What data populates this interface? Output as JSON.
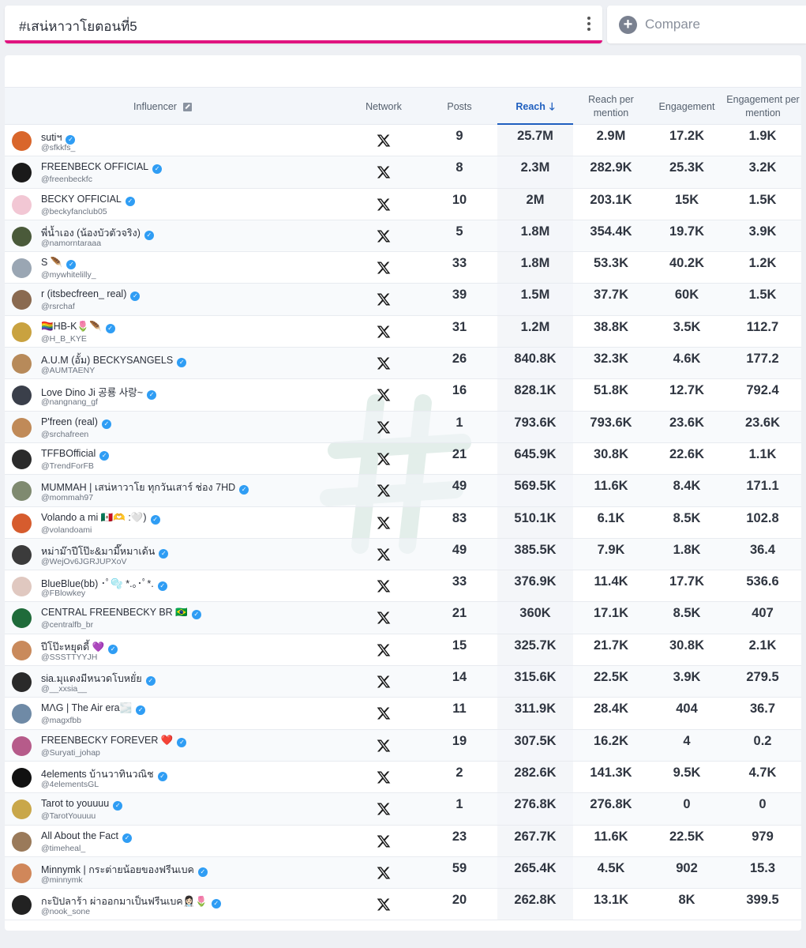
{
  "search": {
    "hashtag": "#เสน่หาวาโยตอนที่5",
    "compare_label": "Compare"
  },
  "table": {
    "headers": {
      "influencer": "Influencer",
      "network": "Network",
      "posts": "Posts",
      "reach": "Reach",
      "reach_per_mention": "Reach per mention",
      "engagement": "Engagement",
      "engagement_per_mention": "Engagement per mention"
    },
    "rows": [
      {
        "name": "sutiฯ",
        "handle": "@sfkkfs_",
        "posts": "9",
        "reach": "25.7M",
        "rpm": "2.9M",
        "eng": "17.2K",
        "epm": "1.9K",
        "avatar": "#d9662b"
      },
      {
        "name": "FREENBECK OFFICIAL",
        "handle": "@freenbeckfc",
        "posts": "8",
        "reach": "2.3M",
        "rpm": "282.9K",
        "eng": "25.3K",
        "epm": "3.2K",
        "avatar": "#1a1a1a"
      },
      {
        "name": "BECKY OFFICIAL",
        "handle": "@beckyfanclub05",
        "posts": "10",
        "reach": "2M",
        "rpm": "203.1K",
        "eng": "15K",
        "epm": "1.5K",
        "avatar": "#f2c7d4"
      },
      {
        "name": "พี่น้ำเอง (น้องบัวตัวจริง)",
        "handle": "@namorntaraaa",
        "posts": "5",
        "reach": "1.8M",
        "rpm": "354.4K",
        "eng": "19.7K",
        "epm": "3.9K",
        "avatar": "#4a5a3a"
      },
      {
        "name": "S 🪶",
        "handle": "@mywhitelilly_",
        "posts": "33",
        "reach": "1.8M",
        "rpm": "53.3K",
        "eng": "40.2K",
        "epm": "1.2K",
        "avatar": "#9aa6b3"
      },
      {
        "name": "r (itsbecfreen_ real)",
        "handle": "@rsrchaf",
        "posts": "39",
        "reach": "1.5M",
        "rpm": "37.7K",
        "eng": "60K",
        "epm": "1.5K",
        "avatar": "#8a6a50"
      },
      {
        "name": "🏳️‍🌈HB-K🌷🪶",
        "handle": "@H_B_KYE",
        "posts": "31",
        "reach": "1.2M",
        "rpm": "38.8K",
        "eng": "3.5K",
        "epm": "112.7",
        "avatar": "#c9a240"
      },
      {
        "name": "A.U.M (อั้ม) BECKYSANGELS",
        "handle": "@AUMTAENY",
        "posts": "26",
        "reach": "840.8K",
        "rpm": "32.3K",
        "eng": "4.6K",
        "epm": "177.2",
        "avatar": "#b78a5a"
      },
      {
        "name": "Love Dino Ji 공룡 사랑~",
        "handle": "@nangnang_gf",
        "posts": "16",
        "reach": "828.1K",
        "rpm": "51.8K",
        "eng": "12.7K",
        "epm": "792.4",
        "avatar": "#3a3f4a"
      },
      {
        "name": "P'freen (real)",
        "handle": "@srchafreen",
        "posts": "1",
        "reach": "793.6K",
        "rpm": "793.6K",
        "eng": "23.6K",
        "epm": "23.6K",
        "avatar": "#c08a58"
      },
      {
        "name": "TFFBOfficial",
        "handle": "@TrendForFB",
        "posts": "21",
        "reach": "645.9K",
        "rpm": "30.8K",
        "eng": "22.6K",
        "epm": "1.1K",
        "avatar": "#2b2b2b"
      },
      {
        "name": "MUMMAH | เสน่หาวาโย ทุกวันเสาร์ ช่อง 7HD",
        "handle": "@mommah97",
        "posts": "49",
        "reach": "569.5K",
        "rpm": "11.6K",
        "eng": "8.4K",
        "epm": "171.1",
        "avatar": "#7f8a70"
      },
      {
        "name": "Volando a mi 🇲🇽🫶 :🤍)",
        "handle": "@volandoami",
        "posts": "83",
        "reach": "510.1K",
        "rpm": "6.1K",
        "eng": "8.5K",
        "epm": "102.8",
        "avatar": "#d65c2e"
      },
      {
        "name": "หม่าม๊าปีโป๊ะ&มามี๊หมาเด้น",
        "handle": "@WejOv6JGRJUPXoV",
        "posts": "49",
        "reach": "385.5K",
        "rpm": "7.9K",
        "eng": "1.8K",
        "epm": "36.4",
        "avatar": "#3b3b3b"
      },
      {
        "name": "BlueBlue(bb) ･ﾟ🫧 *.｡･ﾟ*.",
        "handle": "@FBlowkey",
        "posts": "33",
        "reach": "376.9K",
        "rpm": "11.4K",
        "eng": "17.7K",
        "epm": "536.6",
        "avatar": "#e0c8c0"
      },
      {
        "name": "CENTRAL FREENBECKY BR 🇧🇷",
        "handle": "@centralfb_br",
        "posts": "21",
        "reach": "360K",
        "rpm": "17.1K",
        "eng": "8.5K",
        "epm": "407",
        "avatar": "#1f6b3a"
      },
      {
        "name": "ปีโป๊ะหยุดดี้ 💜",
        "handle": "@SSSTTYYJH",
        "posts": "15",
        "reach": "325.7K",
        "rpm": "21.7K",
        "eng": "30.8K",
        "epm": "2.1K",
        "avatar": "#c98a5c"
      },
      {
        "name": "sia.มุแดงมีหนวดโบหยั่ย",
        "handle": "@__xxsia__",
        "posts": "14",
        "reach": "315.6K",
        "rpm": "22.5K",
        "eng": "3.9K",
        "epm": "279.5",
        "avatar": "#2a2a2a"
      },
      {
        "name": "MΛG | The Air era🌫️",
        "handle": "@magxfbb",
        "posts": "11",
        "reach": "311.9K",
        "rpm": "28.4K",
        "eng": "404",
        "epm": "36.7",
        "avatar": "#6f8aa6"
      },
      {
        "name": "FREENBECKY FOREVER ❤️",
        "handle": "@Suryati_johap",
        "posts": "19",
        "reach": "307.5K",
        "rpm": "16.2K",
        "eng": "4",
        "epm": "0.2",
        "avatar": "#b65b8a"
      },
      {
        "name": "4elements บ้านวาทินวณิช",
        "handle": "@4elementsGL",
        "posts": "2",
        "reach": "282.6K",
        "rpm": "141.3K",
        "eng": "9.5K",
        "epm": "4.7K",
        "avatar": "#111111"
      },
      {
        "name": "Tarot to youuuu",
        "handle": "@TarotYouuuu",
        "posts": "1",
        "reach": "276.8K",
        "rpm": "276.8K",
        "eng": "0",
        "epm": "0",
        "avatar": "#c9a74a"
      },
      {
        "name": "All About the Fact",
        "handle": "@timeheal_",
        "posts": "23",
        "reach": "267.7K",
        "rpm": "11.6K",
        "eng": "22.5K",
        "epm": "979",
        "avatar": "#9a7a5a"
      },
      {
        "name": "Minnymk | กระต่ายน้อยของฟรีนเบค",
        "handle": "@minnymk",
        "posts": "59",
        "reach": "265.4K",
        "rpm": "4.5K",
        "eng": "902",
        "epm": "15.3",
        "avatar": "#d0875a"
      },
      {
        "name": "กะปิปลาร้า ผ่าออกมาเป็นฟรีนเบค👩🏻‍⚕️🌷",
        "handle": "@nook_sone",
        "posts": "20",
        "reach": "262.8K",
        "rpm": "13.1K",
        "eng": "8K",
        "epm": "399.5",
        "avatar": "#222222"
      }
    ]
  }
}
